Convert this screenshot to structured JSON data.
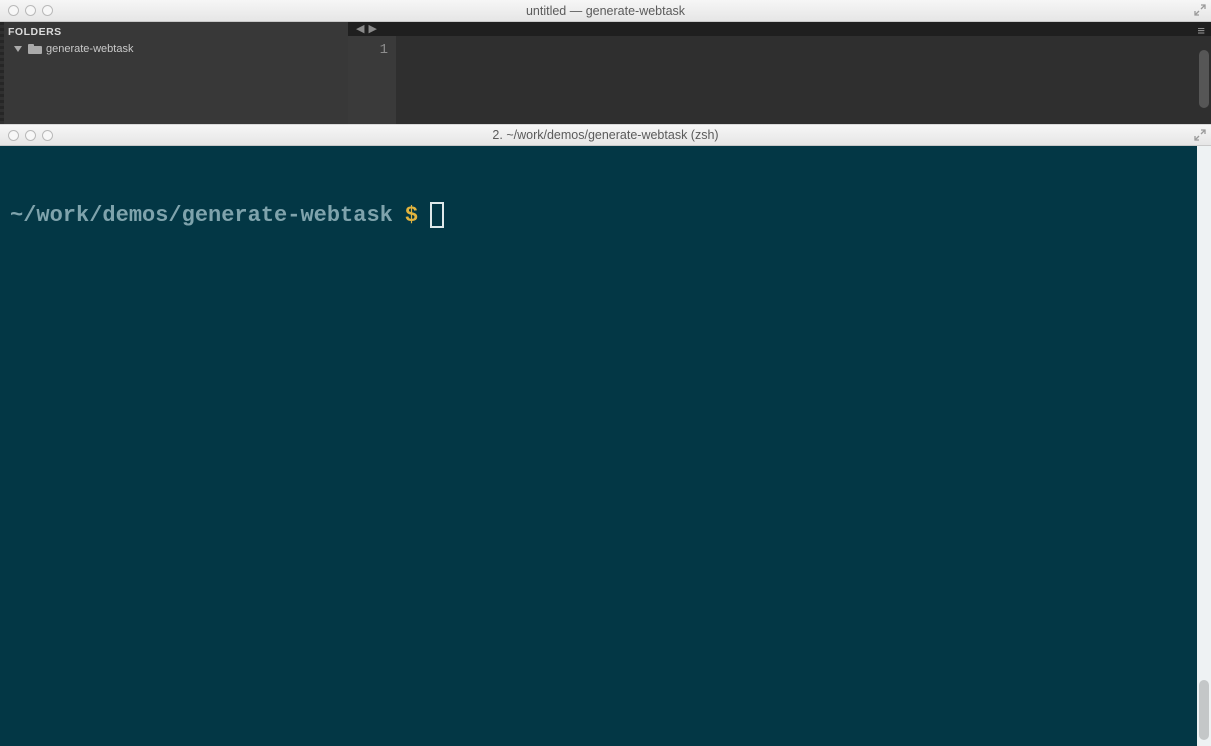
{
  "editor": {
    "title": "untitled — generate-webtask",
    "sidebar": {
      "header": "FOLDERS",
      "root_folder": "generate-webtask"
    },
    "gutter": {
      "lines": [
        "1"
      ]
    }
  },
  "terminal": {
    "title": "2. ~/work/demos/generate-webtask (zsh)",
    "prompt_path": "~/work/demos/generate-webtask",
    "prompt_symbol": "$"
  }
}
